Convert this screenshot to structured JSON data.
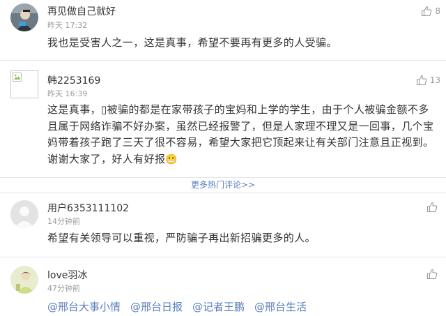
{
  "comments": [
    {
      "username": "再见做自己就好",
      "time": "昨天 17:32",
      "text": "我也是受害人之一，这是真事，希望不要再有更多的人受骗。",
      "likes": "8",
      "avatar": "photo-avatar"
    },
    {
      "username": "韩2253169",
      "time": "昨天 16:39",
      "text": "这是真事，▯被骗的都是在家带孩子的宝妈和上学的学生，由于个人被骗金额不多且属于网络诈骗不好办案，虽然已经报警了，但是人家理不理又是一回事，几个宝妈带着孩子跑了三天了很不容易，希望大家把它顶起来让有关部门注意且正视到。谢谢大家了，好人有好报",
      "emoji": "😬",
      "likes": "13",
      "avatar": "broken-image-avatar"
    },
    {
      "username": "用户6353111102",
      "time": "14分钟前",
      "text": "希望有关领导可以重视，严防骗子再出新招骗更多的人。",
      "likes": "",
      "avatar": "default-avatar"
    },
    {
      "username": "love羽冰",
      "time": "47分钟前",
      "tags": [
        "@邢台大事小情",
        "@邢台日报",
        "@记者王鹏",
        "@邢台生活"
      ],
      "likes": "",
      "avatar": "photo-avatar"
    }
  ],
  "more_link": "更多热门评论>>",
  "colors": {
    "link": "#5b7fbd",
    "meta": "#999999",
    "text": "#333333",
    "divider": "#e6e6e6"
  }
}
